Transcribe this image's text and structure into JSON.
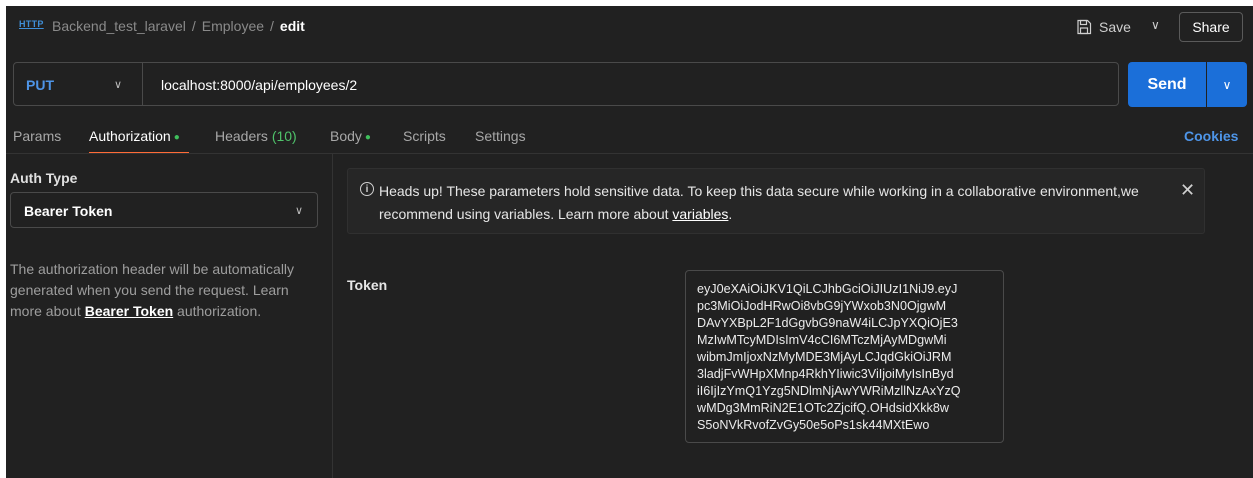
{
  "header": {
    "http_icon_text": "HTTP",
    "breadcrumb": [
      "Backend_test_laravel",
      "Employee",
      "edit"
    ],
    "save_label": "Save",
    "share_label": "Share"
  },
  "request": {
    "method": "PUT",
    "url": "localhost:8000/api/employees/2",
    "send_label": "Send"
  },
  "tabs": {
    "params": "Params",
    "authorization": "Authorization",
    "headers": "Headers",
    "headers_count": "(10)",
    "body": "Body",
    "scripts": "Scripts",
    "settings": "Settings",
    "cookies": "Cookies"
  },
  "auth": {
    "type_label": "Auth Type",
    "type_value": "Bearer Token",
    "desc_before": "The authorization header will be automatically generated when you send the request. Learn more about ",
    "desc_link": "Bearer Token",
    "desc_after": " authorization."
  },
  "notice": {
    "text_before": "Heads up! These parameters hold sensitive data. To keep this data secure while working in a collaborative environment,we recommend using variables. Learn more about ",
    "link": "variables",
    "text_after": "."
  },
  "token": {
    "label": "Token",
    "value": "eyJ0eXAiOiJKV1QiLCJhbGciOiJIUzI1NiJ9.eyJ\npc3MiOiJodHRwOi8vbG9jYWxob3N0OjgwM\nDAvYXBpL2F1dGgvbG9naW4iLCJpYXQiOjE3\nMzIwMTcyMDIsImV4cCI6MTczMjAyMDgwMi\nwibmJmIjoxNzMyMDE3MjAyLCJqdGkiOiJRM\n3ladjFvWHpXMnp4RkhYIiwic3ViIjoiMyIsInByd\niI6IjIzYmQ1Yzg5NDlmNjAwYWRiMzllNzAxYzQ\nwMDg3MmRiN2E1OTc2ZjcifQ.OHdsidXkk8w\nS5oNVkRvofZvGy50e5oPs1sk44MXtEwo"
  },
  "colors": {
    "background": "#212121",
    "accent_blue": "#1b6fd9",
    "method_blue": "#4e95e8",
    "active_tab_underline": "#ff6b37",
    "status_dot_green": "#3fbf5c"
  }
}
